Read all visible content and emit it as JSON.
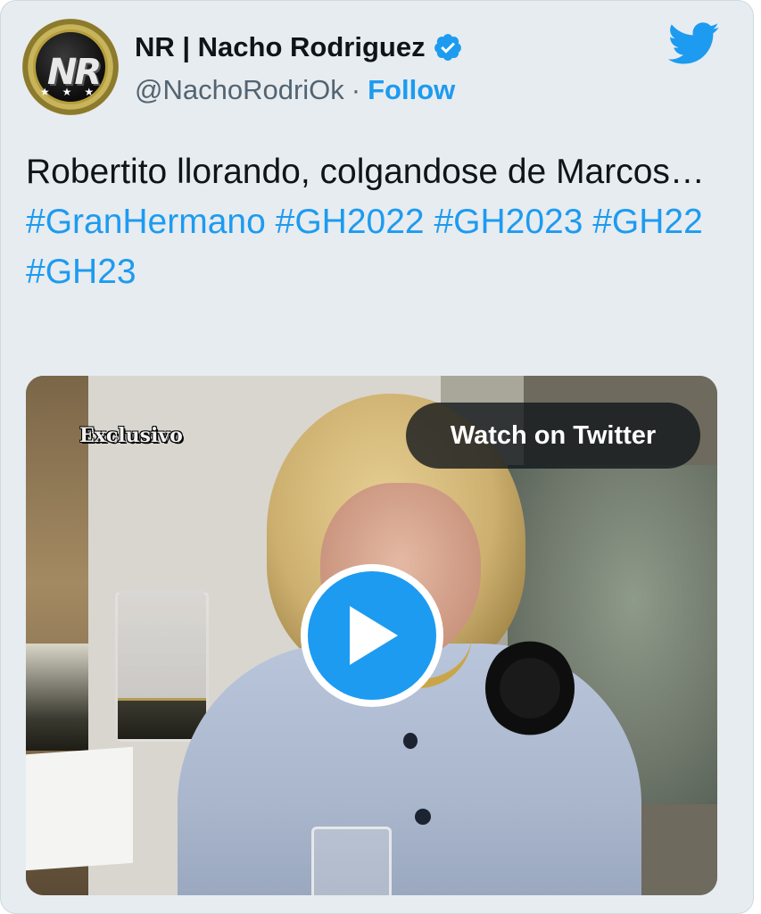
{
  "tweet": {
    "author": {
      "display_name": "NR | Nacho Rodriguez",
      "handle": "@NachoRodriOk",
      "verified": true,
      "avatar_initials": "NR"
    },
    "separator": "·",
    "follow_label": "Follow",
    "text": "Robertito llorando, colgandose de Marcos…",
    "hashtags": [
      "#GranHermano",
      "#GH2022",
      "#GH2023",
      "#GH22",
      "#GH23"
    ],
    "platform_icon": "twitter-bird-icon"
  },
  "media": {
    "overlay_caption": "Exclusivo",
    "watch_label": "Watch on Twitter",
    "play_icon": "play-icon"
  },
  "colors": {
    "accent": "#1d9bf0",
    "text": "#0f1419",
    "muted": "#536471",
    "card_bg": "#e7ecf0"
  }
}
